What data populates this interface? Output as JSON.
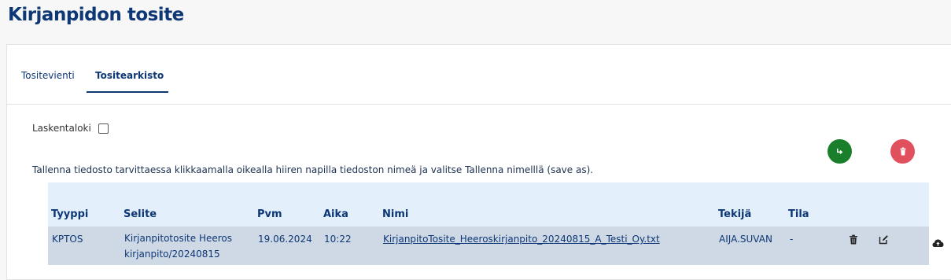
{
  "page": {
    "title": "Kirjanpidon tosite"
  },
  "tabs": [
    {
      "label": "Tositevienti",
      "active": false
    },
    {
      "label": "Tositearkisto",
      "active": true
    }
  ],
  "filters": {
    "laskentaloki_label": "Laskentaloki",
    "laskentaloki_checked": false
  },
  "actions": {
    "forward_icon": "share-arrow-icon",
    "delete_icon": "trash-icon",
    "forward_color": "#1a7f2b",
    "delete_color": "#e0505d"
  },
  "info_text": "Tallenna tiedosto tarvittaessa klikkaamalla oikealla hiiren napilla tiedoston nimeä ja valitse Tallenna nimelllä (save as).",
  "table": {
    "columns": [
      "Tyyppi",
      "Selite",
      "Pvm",
      "Aika",
      "Nimi",
      "Tekijä",
      "Tila"
    ],
    "rows": [
      {
        "tyyppi": "KPTOS",
        "selite_line1": "Kirjanpitotosite Heeros",
        "selite_line2": "kirjanpito/20240815",
        "pvm": "19.06.2024",
        "aika": "10:22",
        "nimi": "KirjanpitoTosite_Heeroskirjanpito_20240815_A_Testi_Oy.txt",
        "tekija": "AIJA.SUVAN",
        "tila": "-"
      }
    ]
  },
  "colors": {
    "title": "#0d3775",
    "header_bg": "#e3f0fb",
    "row_bg": "#cfd9e5"
  }
}
